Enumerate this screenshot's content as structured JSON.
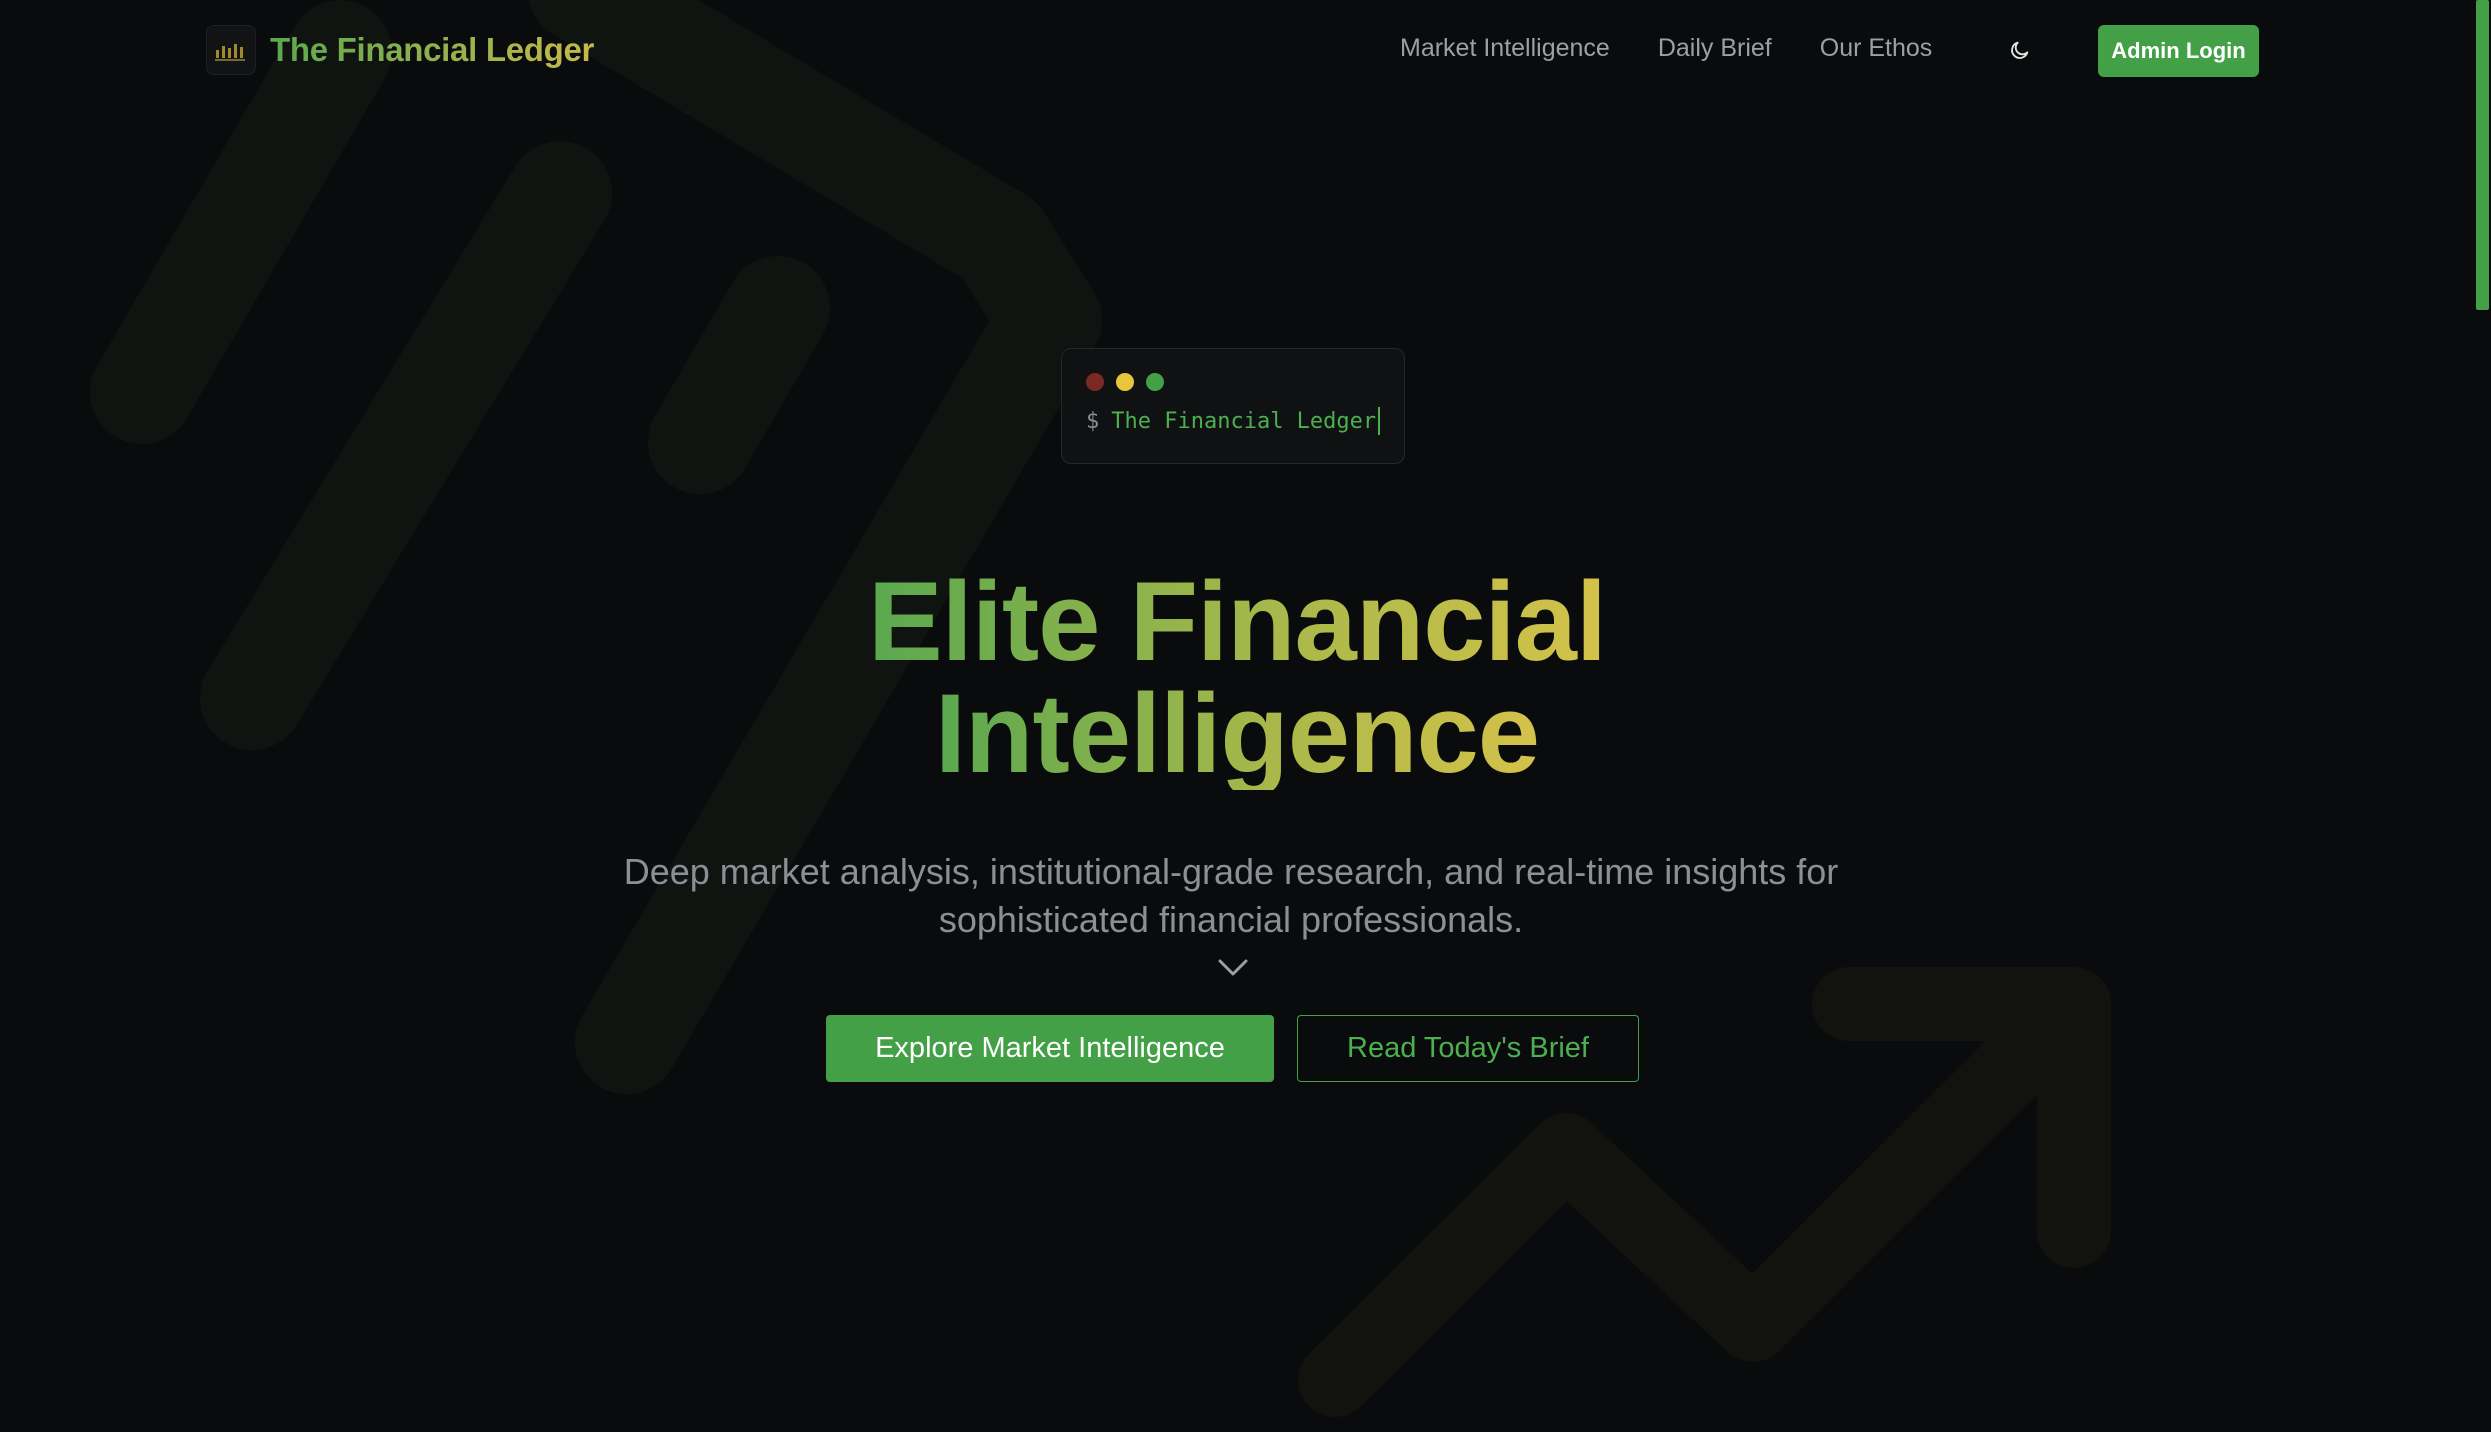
{
  "brand": {
    "name": "The Financial Ledger",
    "logo_icon": "chart-logo-icon"
  },
  "nav": {
    "links": [
      "Market Intelligence",
      "Daily Brief",
      "Our Ethos"
    ],
    "theme_icon": "moon-icon",
    "admin_login": "Admin Login"
  },
  "terminal": {
    "prompt": "$",
    "text": "The Financial Ledger"
  },
  "hero": {
    "title_line1": "Elite Financial",
    "title_line2": "Intelligence",
    "subtitle": "Deep market analysis, institutional-grade research, and real-time insights for sophisticated financial professionals.",
    "chevron_icon": "chevron-down-icon",
    "cta_primary": "Explore Market Intelligence",
    "cta_secondary": "Read Today's Brief"
  },
  "colors": {
    "accent_green": "#43a047",
    "accent_gold": "#d4c24a",
    "background": "#0a0b0d"
  }
}
